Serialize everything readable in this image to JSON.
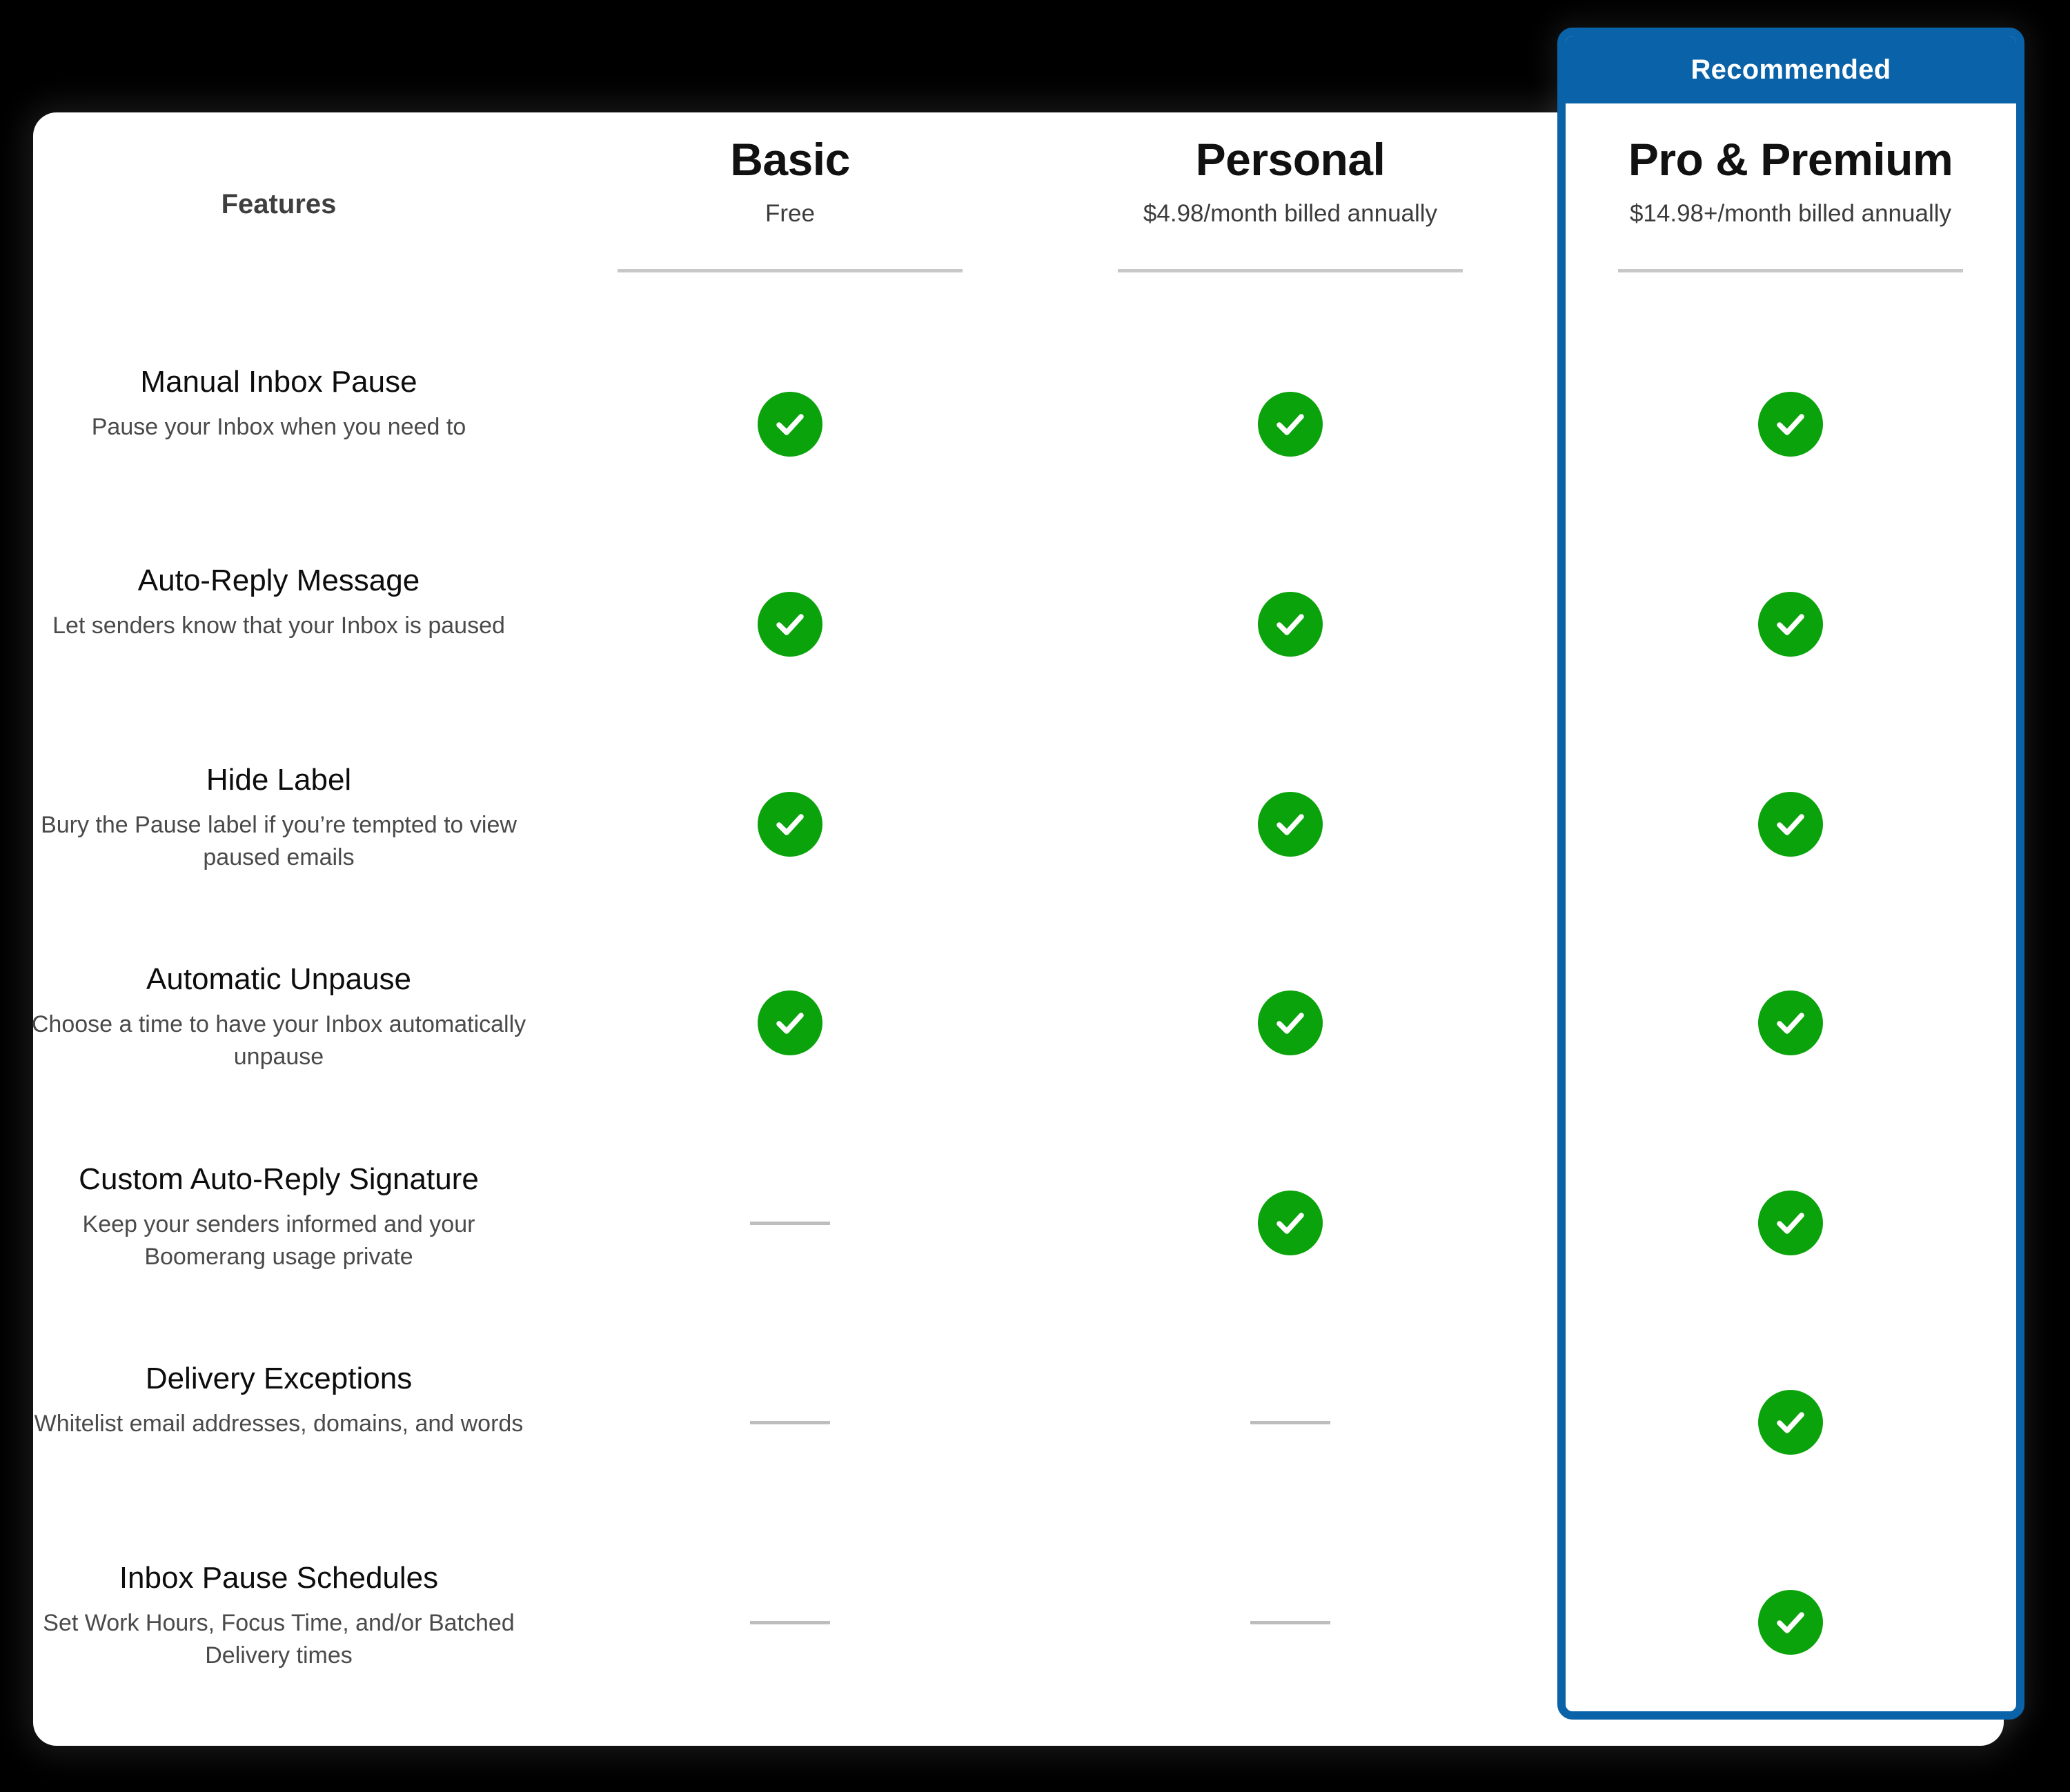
{
  "banner": {
    "label": "Recommended"
  },
  "colors": {
    "accent_blue": "#0a63a8",
    "check_green": "#0ba30b",
    "dash_gray": "#bdbdbd",
    "rule_gray": "#c8c8c8",
    "page_background": "#000000",
    "card_background": "#ffffff"
  },
  "columns": [
    {
      "key": "features",
      "title": "Features",
      "price": ""
    },
    {
      "key": "basic",
      "title": "Basic",
      "price": "Free"
    },
    {
      "key": "personal",
      "title": "Personal",
      "price": "$4.98/month billed annually"
    },
    {
      "key": "pro",
      "title": "Pro & Premium",
      "price": "$14.98+/month billed annually"
    }
  ],
  "icons": {
    "check": "check-circle-icon",
    "dash": "dash-icon"
  },
  "features": [
    {
      "title": "Manual Inbox Pause",
      "description": "Pause your Inbox when you need to",
      "basic": "check",
      "personal": "check",
      "pro": "check"
    },
    {
      "title": "Auto-Reply Message",
      "description": "Let senders know that your Inbox is paused",
      "basic": "check",
      "personal": "check",
      "pro": "check"
    },
    {
      "title": "Hide Label",
      "description": "Bury the Pause label if you’re tempted to view paused emails",
      "basic": "check",
      "personal": "check",
      "pro": "check"
    },
    {
      "title": "Automatic Unpause",
      "description": "Choose a time to have your Inbox automatically unpause",
      "basic": "check",
      "personal": "check",
      "pro": "check"
    },
    {
      "title": "Custom Auto-Reply Signature",
      "description": "Keep your senders informed and your Boomerang usage private",
      "basic": "dash",
      "personal": "check",
      "pro": "check"
    },
    {
      "title": "Delivery Exceptions",
      "description": "Whitelist email addresses, domains, and words",
      "basic": "dash",
      "personal": "dash",
      "pro": "check"
    },
    {
      "title": "Inbox Pause Schedules",
      "description": "Set Work Hours, Focus Time, and/or Batched Delivery times",
      "basic": "dash",
      "personal": "dash",
      "pro": "check"
    }
  ]
}
